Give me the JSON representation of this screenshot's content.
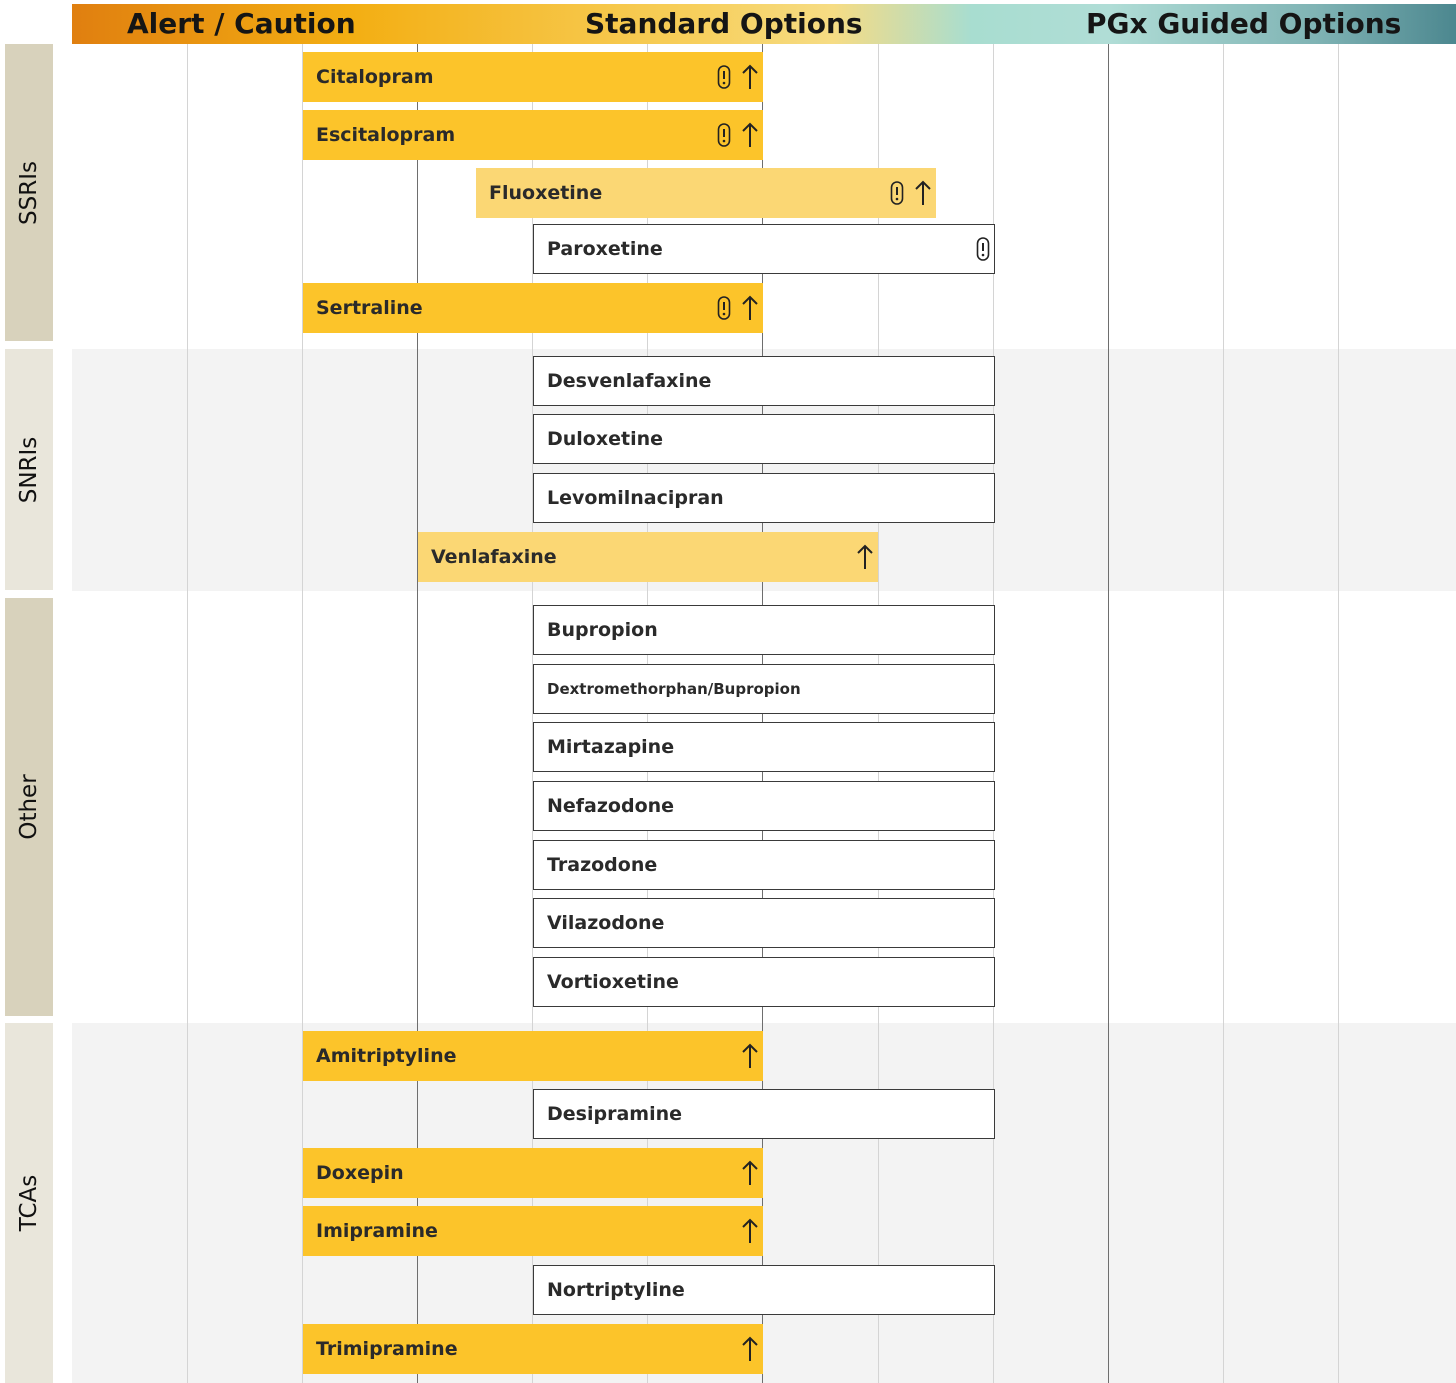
{
  "header": {
    "alert_caution": "Alert / Caution",
    "standard_options": "Standard Options",
    "pgx_guided_options": "PGx Guided Options"
  },
  "colors": {
    "alert": "#fcc42a",
    "caution": "#fbd774",
    "standard": "#ffffff",
    "category_strip_1": "#d8d2bc",
    "category_strip_2": "#e9e6db"
  },
  "categories": [
    {
      "label": "SSRIs",
      "drugs": [
        {
          "name": "Citalopram",
          "level": "alert",
          "icons": [
            "pill-alert-icon",
            "arrow-up-icon"
          ]
        },
        {
          "name": "Escitalopram",
          "level": "alert",
          "icons": [
            "pill-alert-icon",
            "arrow-up-icon"
          ]
        },
        {
          "name": "Fluoxetine",
          "level": "caution",
          "icons": [
            "pill-alert-icon",
            "arrow-up-icon"
          ]
        },
        {
          "name": "Paroxetine",
          "level": "standard",
          "icons": [
            "pill-alert-icon"
          ]
        },
        {
          "name": "Sertraline",
          "level": "alert",
          "icons": [
            "pill-alert-icon",
            "arrow-up-icon"
          ]
        }
      ]
    },
    {
      "label": "SNRIs",
      "drugs": [
        {
          "name": "Desvenlafaxine",
          "level": "standard",
          "icons": []
        },
        {
          "name": "Duloxetine",
          "level": "standard",
          "icons": []
        },
        {
          "name": "Levomilnacipran",
          "level": "standard",
          "icons": []
        },
        {
          "name": "Venlafaxine",
          "level": "caution",
          "icons": [
            "arrow-up-icon"
          ]
        }
      ]
    },
    {
      "label": "Other",
      "drugs": [
        {
          "name": "Bupropion",
          "level": "standard",
          "icons": []
        },
        {
          "name": "Dextromethorphan/Bupropion",
          "level": "standard",
          "icons": []
        },
        {
          "name": "Mirtazapine",
          "level": "standard",
          "icons": []
        },
        {
          "name": "Nefazodone",
          "level": "standard",
          "icons": []
        },
        {
          "name": "Trazodone",
          "level": "standard",
          "icons": []
        },
        {
          "name": "Vilazodone",
          "level": "standard",
          "icons": []
        },
        {
          "name": "Vortioxetine",
          "level": "standard",
          "icons": []
        }
      ]
    },
    {
      "label": "TCAs",
      "drugs": [
        {
          "name": "Amitriptyline",
          "level": "alert",
          "icons": [
            "arrow-up-icon"
          ]
        },
        {
          "name": "Desipramine",
          "level": "standard",
          "icons": []
        },
        {
          "name": "Doxepin",
          "level": "alert",
          "icons": [
            "arrow-up-icon"
          ]
        },
        {
          "name": "Imipramine",
          "level": "alert",
          "icons": [
            "arrow-up-icon"
          ]
        },
        {
          "name": "Nortriptyline",
          "level": "standard",
          "icons": []
        },
        {
          "name": "Trimipramine",
          "level": "alert",
          "icons": [
            "arrow-up-icon"
          ]
        }
      ]
    }
  ]
}
